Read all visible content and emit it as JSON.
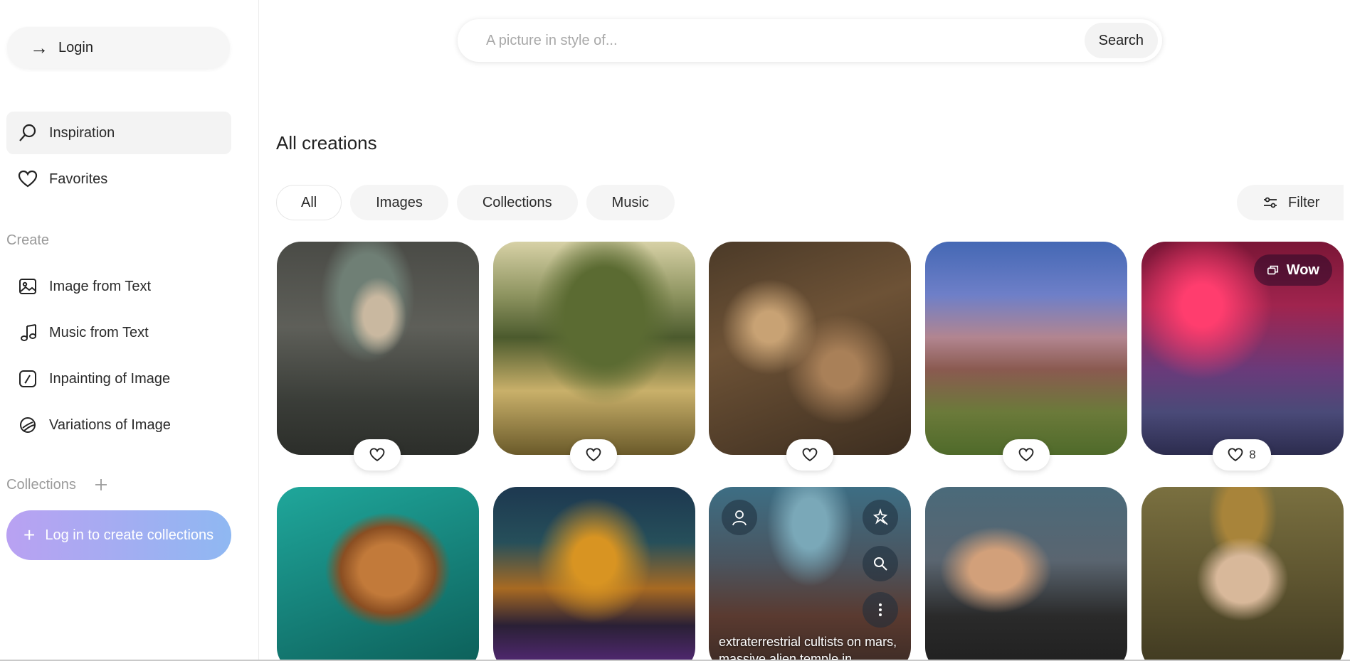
{
  "sidebar": {
    "login_label": "Login",
    "nav": [
      {
        "label": "Inspiration",
        "icon": "search-icon",
        "active": true
      },
      {
        "label": "Favorites",
        "icon": "heart-icon",
        "active": false
      }
    ],
    "create_label": "Create",
    "create_items": [
      {
        "label": "Image from Text",
        "icon": "image-icon"
      },
      {
        "label": "Music from Text",
        "icon": "music-note-icon"
      },
      {
        "label": "Inpainting of Image",
        "icon": "inpainting-icon"
      },
      {
        "label": "Variations of Image",
        "icon": "variations-icon"
      }
    ],
    "collections_label": "Collections",
    "create_collections_label": "Log in to create collections"
  },
  "search": {
    "placeholder": "A picture in style of...",
    "value": "",
    "button_label": "Search"
  },
  "main": {
    "title": "All creations",
    "tabs": [
      {
        "label": "All",
        "active": true
      },
      {
        "label": "Images",
        "active": false
      },
      {
        "label": "Collections",
        "active": false
      },
      {
        "label": "Music",
        "active": false
      }
    ],
    "filter_label": "Filter",
    "cards": [
      {
        "like_count": ""
      },
      {
        "like_count": ""
      },
      {
        "like_count": ""
      },
      {
        "like_count": ""
      },
      {
        "like_count": "8",
        "badge": "Wow"
      },
      {},
      {},
      {
        "caption": "extraterrestrial cultists on mars, massive alien temple in"
      },
      {},
      {}
    ]
  },
  "colors": {
    "accent_gradient_start": "#b9a1f2",
    "accent_gradient_end": "#8fb8f2",
    "active_bg": "#f3f3f3"
  }
}
